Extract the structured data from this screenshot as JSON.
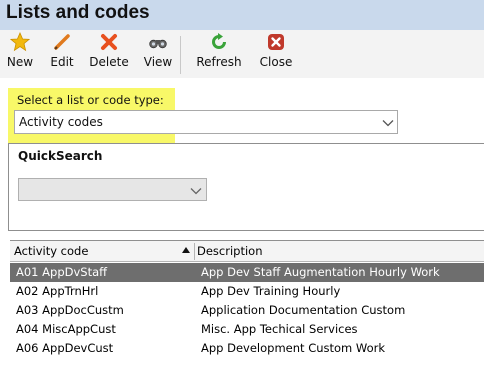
{
  "header": {
    "title": "Lists and codes"
  },
  "toolbar": {
    "buttons": [
      {
        "label": "New",
        "icon": "star-icon"
      },
      {
        "label": "Edit",
        "icon": "pencil-icon"
      },
      {
        "label": "Delete",
        "icon": "x-icon"
      },
      {
        "label": "View",
        "icon": "binoculars-icon"
      },
      {
        "label": "Refresh",
        "icon": "refresh-icon"
      },
      {
        "label": "Close",
        "icon": "close-icon"
      }
    ]
  },
  "list_type": {
    "label": "Select a list or code type:",
    "value": "Activity codes"
  },
  "quicksearch": {
    "title": "QuickSearch",
    "value": ""
  },
  "grid": {
    "columns": [
      "Activity code",
      "Description"
    ],
    "sort_column": "Activity code",
    "sort_direction": "ascending",
    "rows": [
      {
        "code": "A01 AppDvStaff",
        "description": "App Dev Staff Augmentation Hourly Work",
        "selected": true
      },
      {
        "code": "A02 AppTrnHrl",
        "description": "App Dev Training Hourly",
        "selected": false
      },
      {
        "code": "A03 AppDocCustm",
        "description": "Application Documentation Custom",
        "selected": false
      },
      {
        "code": "A04 MiscAppCust",
        "description": "Misc. App Techical Services",
        "selected": false
      },
      {
        "code": "A06 AppDevCust",
        "description": "App Development Custom Work",
        "selected": false
      }
    ]
  },
  "colors": {
    "title_bar": "#c9d9ec",
    "highlight": "#f7f74e",
    "selected_row": "#6e6e6e",
    "star": "#f2b90f",
    "edit": "#e07a1e",
    "delete": "#e8501e",
    "refresh": "#3aa33a",
    "close": "#c0392b"
  }
}
